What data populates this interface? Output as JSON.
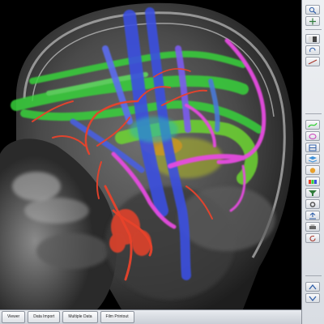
{
  "viewer": {
    "corner_lines": [
      "",
      "",
      ""
    ]
  },
  "tabs": [
    {
      "label": "Viewer"
    },
    {
      "label": "Data Import"
    },
    {
      "label": "Multiple Data"
    },
    {
      "label": "Film Printout"
    }
  ],
  "tools": [
    {
      "icon": "zoom-icon"
    },
    {
      "icon": "pan-icon"
    },
    {
      "icon": "window-level-icon"
    },
    {
      "icon": "rotate-icon"
    },
    {
      "icon": "measure-icon"
    },
    {
      "icon": "tract-icon"
    },
    {
      "icon": "roi-icon"
    },
    {
      "icon": "slice-icon"
    },
    {
      "icon": "layers-icon"
    },
    {
      "icon": "render-icon"
    },
    {
      "icon": "color-map-icon"
    },
    {
      "icon": "fiber-filter-icon"
    },
    {
      "icon": "settings-icon"
    },
    {
      "icon": "export-icon"
    },
    {
      "icon": "print-icon"
    },
    {
      "icon": "reset-icon"
    }
  ],
  "colors": {
    "tract_green": "#37d13a",
    "tract_blue": "#3b4fe0",
    "tract_magenta": "#e64be0",
    "vessel_red": "#e8432c",
    "tract_orange": "#d8961d"
  }
}
